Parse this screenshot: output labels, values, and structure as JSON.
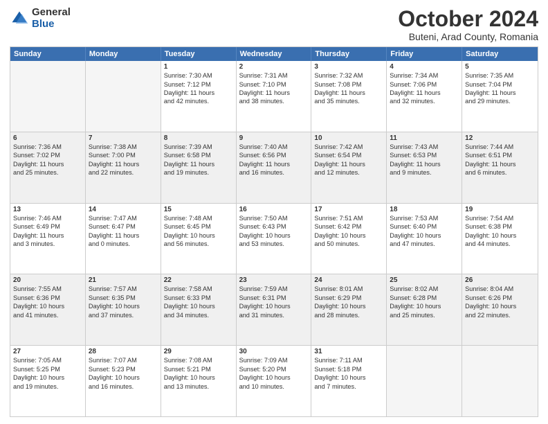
{
  "logo": {
    "general": "General",
    "blue": "Blue"
  },
  "title": "October 2024",
  "location": "Buteni, Arad County, Romania",
  "days_of_week": [
    "Sunday",
    "Monday",
    "Tuesday",
    "Wednesday",
    "Thursday",
    "Friday",
    "Saturday"
  ],
  "weeks": [
    [
      {
        "day": "",
        "empty": true
      },
      {
        "day": "",
        "empty": true
      },
      {
        "day": "1",
        "lines": [
          "Sunrise: 7:30 AM",
          "Sunset: 7:12 PM",
          "Daylight: 11 hours",
          "and 42 minutes."
        ]
      },
      {
        "day": "2",
        "lines": [
          "Sunrise: 7:31 AM",
          "Sunset: 7:10 PM",
          "Daylight: 11 hours",
          "and 38 minutes."
        ]
      },
      {
        "day": "3",
        "lines": [
          "Sunrise: 7:32 AM",
          "Sunset: 7:08 PM",
          "Daylight: 11 hours",
          "and 35 minutes."
        ]
      },
      {
        "day": "4",
        "lines": [
          "Sunrise: 7:34 AM",
          "Sunset: 7:06 PM",
          "Daylight: 11 hours",
          "and 32 minutes."
        ]
      },
      {
        "day": "5",
        "lines": [
          "Sunrise: 7:35 AM",
          "Sunset: 7:04 PM",
          "Daylight: 11 hours",
          "and 29 minutes."
        ]
      }
    ],
    [
      {
        "day": "6",
        "lines": [
          "Sunrise: 7:36 AM",
          "Sunset: 7:02 PM",
          "Daylight: 11 hours",
          "and 25 minutes."
        ]
      },
      {
        "day": "7",
        "lines": [
          "Sunrise: 7:38 AM",
          "Sunset: 7:00 PM",
          "Daylight: 11 hours",
          "and 22 minutes."
        ]
      },
      {
        "day": "8",
        "lines": [
          "Sunrise: 7:39 AM",
          "Sunset: 6:58 PM",
          "Daylight: 11 hours",
          "and 19 minutes."
        ]
      },
      {
        "day": "9",
        "lines": [
          "Sunrise: 7:40 AM",
          "Sunset: 6:56 PM",
          "Daylight: 11 hours",
          "and 16 minutes."
        ]
      },
      {
        "day": "10",
        "lines": [
          "Sunrise: 7:42 AM",
          "Sunset: 6:54 PM",
          "Daylight: 11 hours",
          "and 12 minutes."
        ]
      },
      {
        "day": "11",
        "lines": [
          "Sunrise: 7:43 AM",
          "Sunset: 6:53 PM",
          "Daylight: 11 hours",
          "and 9 minutes."
        ]
      },
      {
        "day": "12",
        "lines": [
          "Sunrise: 7:44 AM",
          "Sunset: 6:51 PM",
          "Daylight: 11 hours",
          "and 6 minutes."
        ]
      }
    ],
    [
      {
        "day": "13",
        "lines": [
          "Sunrise: 7:46 AM",
          "Sunset: 6:49 PM",
          "Daylight: 11 hours",
          "and 3 minutes."
        ]
      },
      {
        "day": "14",
        "lines": [
          "Sunrise: 7:47 AM",
          "Sunset: 6:47 PM",
          "Daylight: 11 hours",
          "and 0 minutes."
        ]
      },
      {
        "day": "15",
        "lines": [
          "Sunrise: 7:48 AM",
          "Sunset: 6:45 PM",
          "Daylight: 10 hours",
          "and 56 minutes."
        ]
      },
      {
        "day": "16",
        "lines": [
          "Sunrise: 7:50 AM",
          "Sunset: 6:43 PM",
          "Daylight: 10 hours",
          "and 53 minutes."
        ]
      },
      {
        "day": "17",
        "lines": [
          "Sunrise: 7:51 AM",
          "Sunset: 6:42 PM",
          "Daylight: 10 hours",
          "and 50 minutes."
        ]
      },
      {
        "day": "18",
        "lines": [
          "Sunrise: 7:53 AM",
          "Sunset: 6:40 PM",
          "Daylight: 10 hours",
          "and 47 minutes."
        ]
      },
      {
        "day": "19",
        "lines": [
          "Sunrise: 7:54 AM",
          "Sunset: 6:38 PM",
          "Daylight: 10 hours",
          "and 44 minutes."
        ]
      }
    ],
    [
      {
        "day": "20",
        "lines": [
          "Sunrise: 7:55 AM",
          "Sunset: 6:36 PM",
          "Daylight: 10 hours",
          "and 41 minutes."
        ]
      },
      {
        "day": "21",
        "lines": [
          "Sunrise: 7:57 AM",
          "Sunset: 6:35 PM",
          "Daylight: 10 hours",
          "and 37 minutes."
        ]
      },
      {
        "day": "22",
        "lines": [
          "Sunrise: 7:58 AM",
          "Sunset: 6:33 PM",
          "Daylight: 10 hours",
          "and 34 minutes."
        ]
      },
      {
        "day": "23",
        "lines": [
          "Sunrise: 7:59 AM",
          "Sunset: 6:31 PM",
          "Daylight: 10 hours",
          "and 31 minutes."
        ]
      },
      {
        "day": "24",
        "lines": [
          "Sunrise: 8:01 AM",
          "Sunset: 6:29 PM",
          "Daylight: 10 hours",
          "and 28 minutes."
        ]
      },
      {
        "day": "25",
        "lines": [
          "Sunrise: 8:02 AM",
          "Sunset: 6:28 PM",
          "Daylight: 10 hours",
          "and 25 minutes."
        ]
      },
      {
        "day": "26",
        "lines": [
          "Sunrise: 8:04 AM",
          "Sunset: 6:26 PM",
          "Daylight: 10 hours",
          "and 22 minutes."
        ]
      }
    ],
    [
      {
        "day": "27",
        "lines": [
          "Sunrise: 7:05 AM",
          "Sunset: 5:25 PM",
          "Daylight: 10 hours",
          "and 19 minutes."
        ]
      },
      {
        "day": "28",
        "lines": [
          "Sunrise: 7:07 AM",
          "Sunset: 5:23 PM",
          "Daylight: 10 hours",
          "and 16 minutes."
        ]
      },
      {
        "day": "29",
        "lines": [
          "Sunrise: 7:08 AM",
          "Sunset: 5:21 PM",
          "Daylight: 10 hours",
          "and 13 minutes."
        ]
      },
      {
        "day": "30",
        "lines": [
          "Sunrise: 7:09 AM",
          "Sunset: 5:20 PM",
          "Daylight: 10 hours",
          "and 10 minutes."
        ]
      },
      {
        "day": "31",
        "lines": [
          "Sunrise: 7:11 AM",
          "Sunset: 5:18 PM",
          "Daylight: 10 hours",
          "and 7 minutes."
        ]
      },
      {
        "day": "",
        "empty": true
      },
      {
        "day": "",
        "empty": true
      }
    ]
  ]
}
